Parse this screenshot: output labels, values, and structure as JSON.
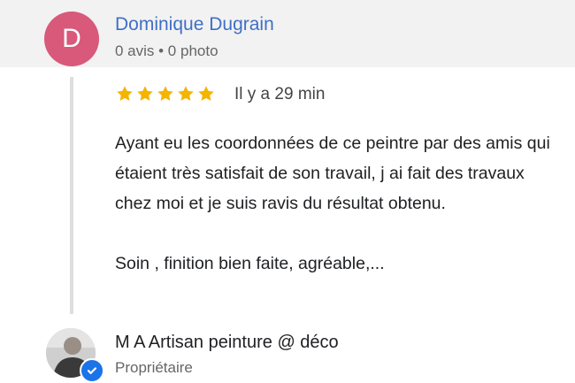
{
  "reviewer": {
    "initial": "D",
    "name": "Dominique Dugrain",
    "meta": "0 avis • 0 photo",
    "avatar_color": "#d8597a",
    "name_color": "#3f6fc6"
  },
  "review": {
    "rating": 5,
    "time": "Il y a 29 min",
    "paragraphs": [
      "Ayant eu les coordonnées de ce peintre par des amis qui étaient très satisfait de son travail, j ai fait des travaux chez moi et je suis ravis du résultat obtenu.",
      "Soin , finition bien faite, agréable,..."
    ],
    "star_color": "#f4b400"
  },
  "owner": {
    "name": "M A Artisan peinture @ déco",
    "role": "Propriétaire",
    "badge_icon": "verified-check-icon",
    "badge_color": "#1a73e8"
  }
}
